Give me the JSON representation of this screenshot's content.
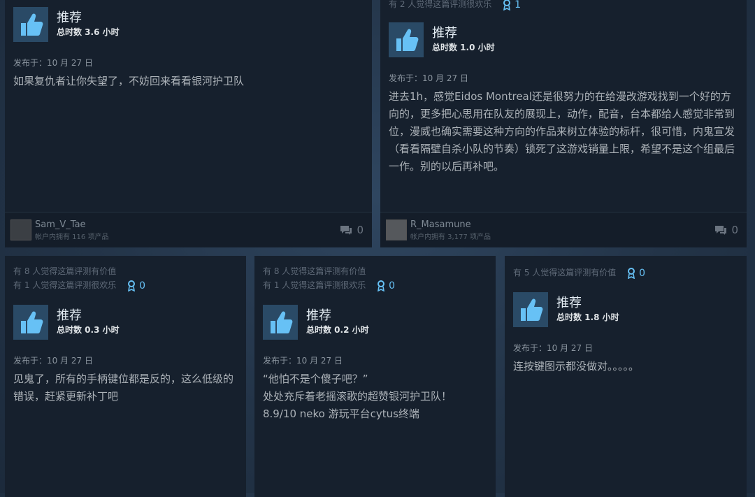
{
  "reviews": [
    {
      "helpful": [],
      "funny": "",
      "awards": "",
      "recommendation": "推荐",
      "hours": "总时数 3.6 小时",
      "posted": "发布于：10 月 27 日",
      "body": "如果复仇者让你失望了，不妨回来看看银河护卫队",
      "author": "Sam_V_Tae",
      "products": "帐户内拥有 116 项产品",
      "comments": "0"
    },
    {
      "helpful": [],
      "funny": "有 2 人觉得这篇评测很欢乐",
      "awards": "1",
      "recommendation": "推荐",
      "hours": "总时数 1.0 小时",
      "posted": "发布于：10 月 27 日",
      "body": "进去1h，感觉Eidos Montreal还是很努力的在给漫改游戏找到一个好的方向的，更多把心思用在队友的展现上，动作，配音，台本都给人感觉非常到位，漫威也确实需要这种方向的作品来树立体验的标杆，很可惜，内鬼宣发（看看隔壁自杀小队的节奏）锁死了这游戏销量上限，希望不是这个组最后一作。别的以后再补吧。",
      "author": "R_Masamune",
      "products": "帐户内拥有 3,177 项产品",
      "comments": "0"
    },
    {
      "helpful": "有 8 人觉得这篇评测有价值",
      "funny": "有 1 人觉得这篇评测很欢乐",
      "awards": "0",
      "recommendation": "推荐",
      "hours": "总时数 0.3 小时",
      "posted": "发布于：10 月 27 日",
      "body": "见鬼了，所有的手柄键位都是反的，这么低级的错误，赶紧更新补丁吧"
    },
    {
      "helpful": "有 8 人觉得这篇评测有价值",
      "funny": "有 1 人觉得这篇评测很欢乐",
      "awards": "0",
      "recommendation": "推荐",
      "hours": "总时数 0.2 小时",
      "posted": "发布于：10 月 27 日",
      "body_lines": [
        "“他怕不是个傻子吧？”",
        "处处充斥着老摇滚歌的超赞银河护卫队！",
        "8.9/10 neko 游玩平台cytus终端"
      ]
    },
    {
      "helpful": "有 5 人觉得这篇评测有价值",
      "awards": "0",
      "recommendation": "推荐",
      "hours": "总时数 1.8 小时",
      "posted": "发布于：10 月 27 日",
      "body": "连按键图示都没做对。。。。。"
    }
  ],
  "colors": {
    "accent": "#66c0f4",
    "card": "#16202d",
    "background": "#233448"
  }
}
